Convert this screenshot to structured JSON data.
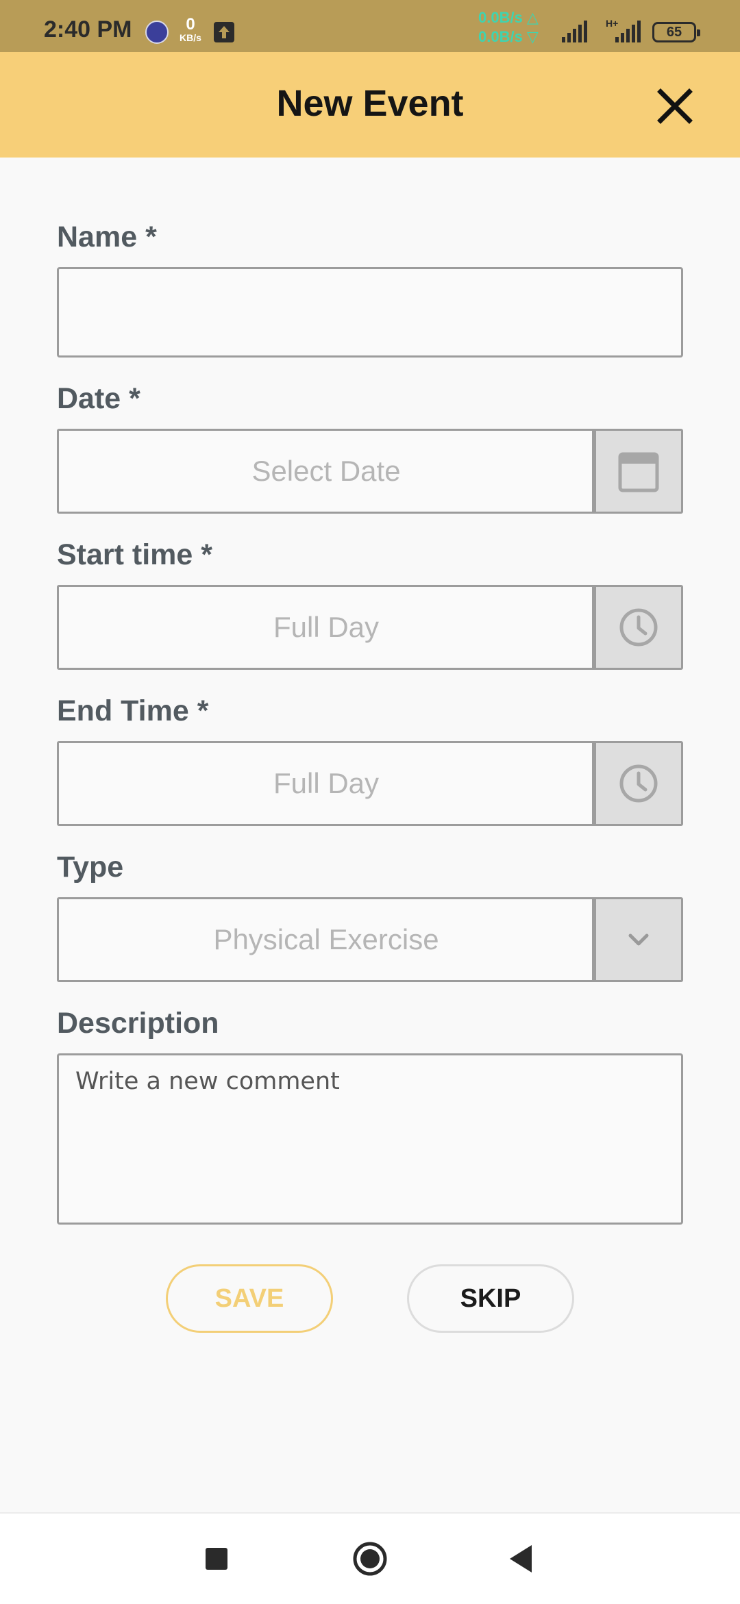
{
  "status_bar": {
    "time": "2:40 PM",
    "speed_value": "0",
    "speed_unit": "KB/s",
    "net_up": "0.0B/s △",
    "net_down": "0.0B/s ▽",
    "network_type": "H+",
    "battery": "65"
  },
  "header": {
    "title": "New Event",
    "close_icon": "close-icon"
  },
  "form": {
    "name": {
      "label": "Name *",
      "value": ""
    },
    "date": {
      "label": "Date *",
      "placeholder": "Select Date",
      "icon": "calendar-icon"
    },
    "start_time": {
      "label": "Start time *",
      "value": "Full Day",
      "icon": "clock-icon"
    },
    "end_time": {
      "label": "End Time *",
      "value": "Full Day",
      "icon": "clock-icon"
    },
    "type": {
      "label": "Type",
      "value": "Physical Exercise",
      "icon": "chevron-down-icon"
    },
    "description": {
      "label": "Description",
      "placeholder": "Write a new comment"
    }
  },
  "actions": {
    "save_label": "SAVE",
    "skip_label": "SKIP"
  },
  "colors": {
    "status_bar": "#b89c57",
    "header": "#f7cf78",
    "accent": "#f3cf77",
    "label": "#525a60",
    "border": "#9c9c9c",
    "net_speed": "#3fd4b0"
  }
}
